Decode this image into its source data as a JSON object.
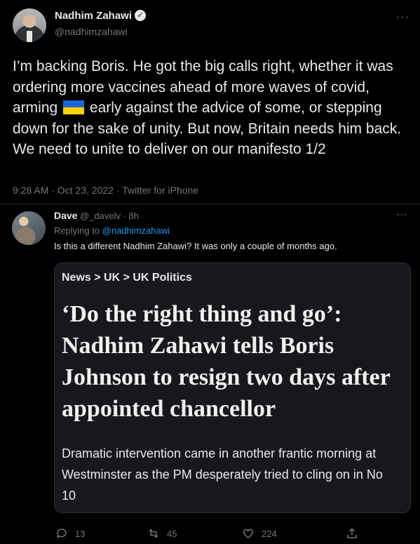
{
  "main_tweet": {
    "author_name": "Nadhim Zahawi",
    "verified_symbol": "✓",
    "handle": "@nadhimzahawi",
    "more_symbol": "···",
    "text_before_flag": "I’m backing Boris. He got the big calls right, whether it was ordering more vaccines ahead of more waves of covid, arming",
    "text_after_flag": "early against the advice of some, or stepping down for the sake of unity. But now, Britain needs him back. We need to unite to deliver on our manifesto 1/2",
    "flag_icon": "ukraine-flag",
    "timestamp": "9:28 AM · Oct 23, 2022 · Twitter for iPhone"
  },
  "reply": {
    "author_name": "Dave",
    "handle_time": "@_davelv · 8h",
    "more_symbol": "···",
    "replying_prefix": "Replying to",
    "replying_mention": "@nadhimzahawi",
    "text": "Is this a different Nadhim Zahawi?  It was only a couple of months ago.",
    "card": {
      "breadcrumb": "News > UK > UK Politics",
      "headline": "‘Do the right thing and go’: Nadhim Zahawi tells Boris Johnson to resign two days after appointed chancellor",
      "standfirst": "Dramatic intervention came in another frantic morning at Westminster as the PM desperately tried to cling on in No 10"
    },
    "actions": {
      "replies": "13",
      "retweets": "45",
      "likes": "224"
    }
  },
  "colors": {
    "background": "#000000",
    "text": "#e7e9ea",
    "muted": "#71767b",
    "link": "#1d9bf0",
    "card_bg": "#16181c",
    "border": "#2f3336"
  }
}
